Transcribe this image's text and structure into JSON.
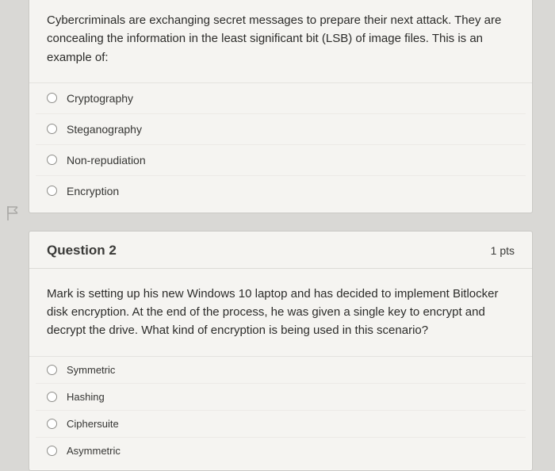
{
  "flag_name": "flag-icon",
  "q1": {
    "text": "Cybercriminals are exchanging secret messages to prepare their next attack. They are concealing the information in the least significant bit (LSB) of image files. This is an example of:",
    "options": [
      "Cryptography",
      "Steganography",
      "Non-repudiation",
      "Encryption"
    ]
  },
  "q2": {
    "title": "Question 2",
    "pts": "1 pts",
    "text": "Mark is setting up his new Windows 10 laptop and has decided to implement Bitlocker disk encryption. At the end of the process, he was given a single key to encrypt and decrypt the drive. What kind of encryption is being used in this scenario?",
    "options": [
      "Symmetric",
      "Hashing",
      "Ciphersuite",
      "Asymmetric"
    ]
  }
}
